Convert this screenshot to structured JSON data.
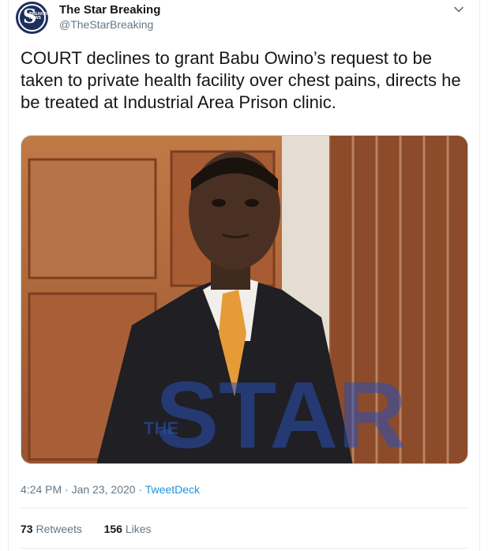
{
  "tweet": {
    "author_name": "The Star Breaking",
    "author_handle": "@TheStarBreaking",
    "avatar_glyph": "S",
    "avatar_subtext": "BREAKING NEWS",
    "text": "COURT declines to grant Babu Owino’s request to be taken to private health facility over chest pains, directs he be treated at Industrial Area Prison clinic.",
    "time": "4:24 PM",
    "date": "Jan 23, 2020",
    "separator": "·",
    "source": "TweetDeck",
    "retweets_count": "73",
    "retweets_label": "Retweets",
    "likes_count": "156",
    "likes_label": "Likes",
    "watermark_small": "THE",
    "watermark_large": "STAR"
  },
  "icons": {
    "menu": "chevron-down-icon",
    "avatar": "avatar-logo-icon"
  },
  "colors": {
    "link": "#1b95e0",
    "secondary_text": "#657786",
    "primary_text": "#14171a",
    "border": "#e6ecf0",
    "avatar_bg": "#1c2f5c"
  }
}
